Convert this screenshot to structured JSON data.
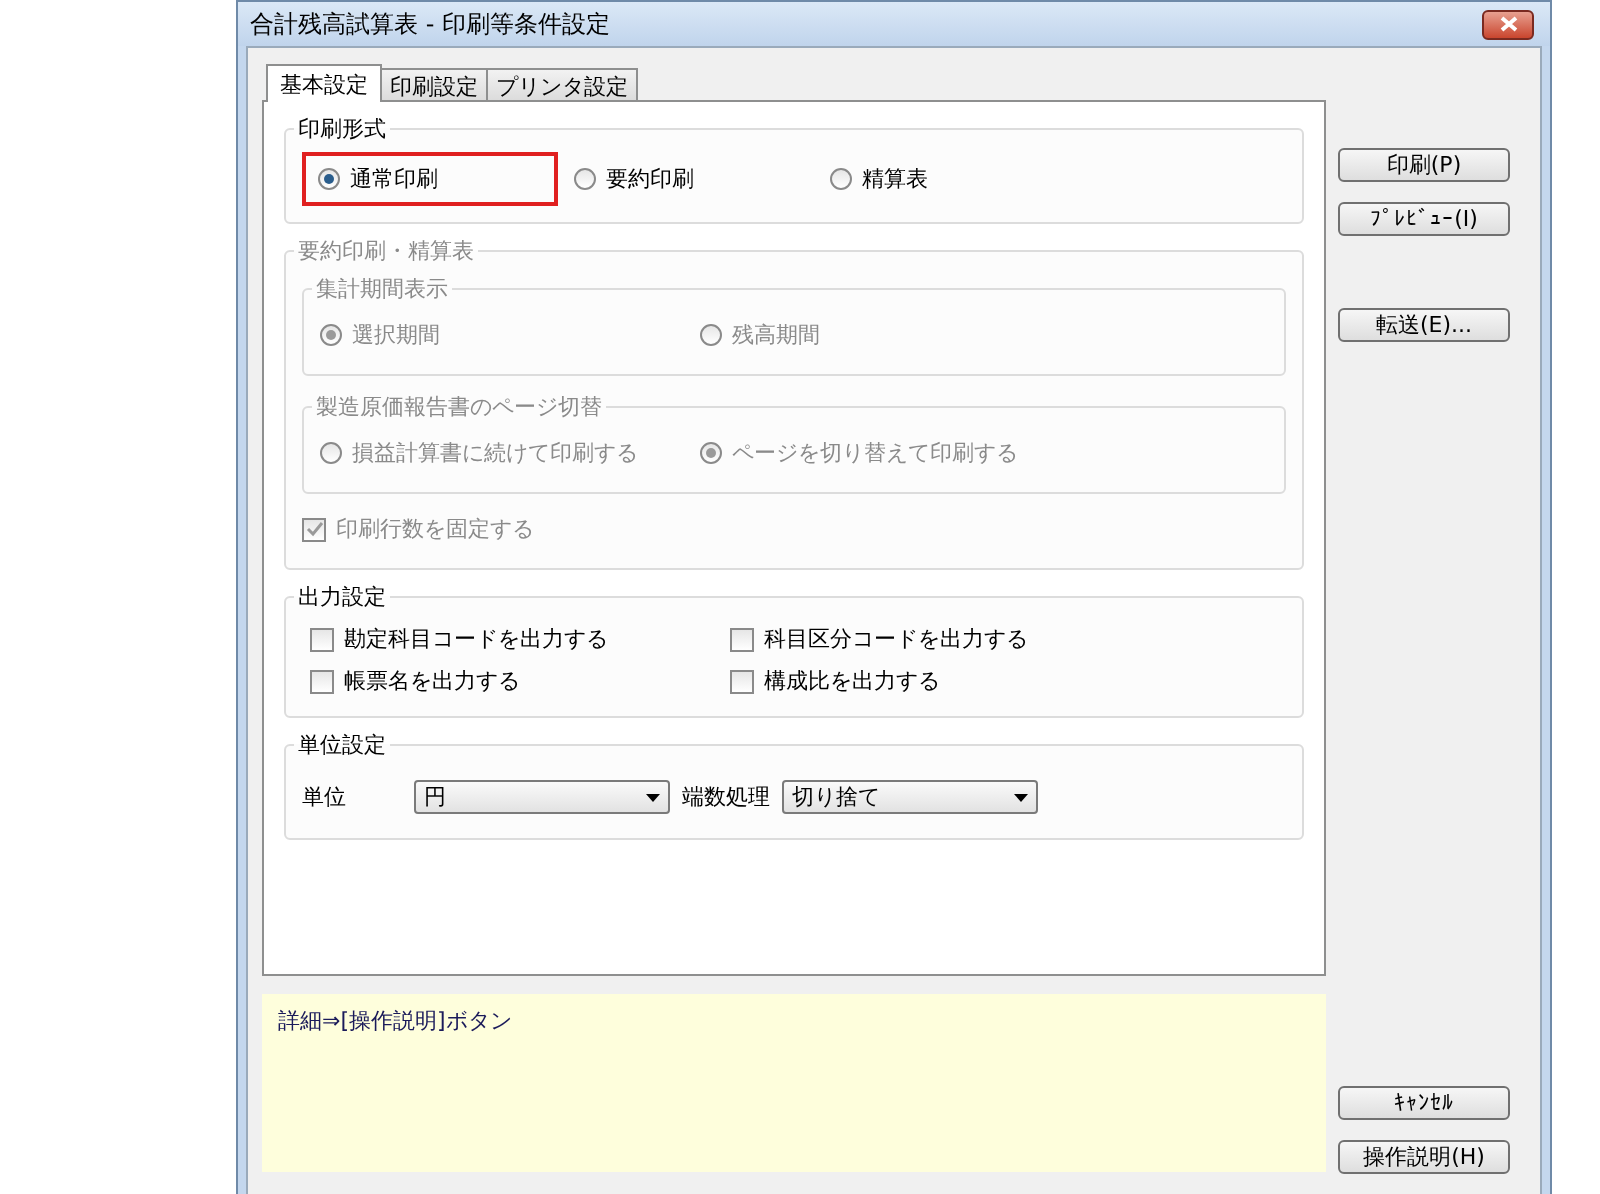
{
  "window": {
    "title": "合計残高試算表 - 印刷等条件設定"
  },
  "tabs": [
    {
      "label": "基本設定",
      "selected": true
    },
    {
      "label": "印刷設定",
      "selected": false
    },
    {
      "label": "プリンタ設定",
      "selected": false
    }
  ],
  "print_format": {
    "title": "印刷形式",
    "options": [
      {
        "label": "通常印刷",
        "selected": true,
        "highlighted": true
      },
      {
        "label": "要約印刷",
        "selected": false,
        "highlighted": false
      },
      {
        "label": "精算表",
        "selected": false,
        "highlighted": false
      }
    ]
  },
  "summary_group": {
    "title": "要約印刷・精算表",
    "disabled": true,
    "subgroups": [
      {
        "title": "集計期間表示",
        "options": [
          {
            "label": "選択期間",
            "selected": true
          },
          {
            "label": "残高期間",
            "selected": false
          }
        ]
      },
      {
        "title": "製造原価報告書のページ切替",
        "options": [
          {
            "label": "損益計算書に続けて印刷する",
            "selected": false
          },
          {
            "label": "ページを切り替えて印刷する",
            "selected": true
          }
        ]
      }
    ],
    "fixed_lines": {
      "label": "印刷行数を固定する",
      "checked": true
    }
  },
  "output_settings": {
    "title": "出力設定",
    "checkboxes": [
      {
        "label": "勘定科目コードを出力する",
        "checked": false
      },
      {
        "label": "科目区分コードを出力する",
        "checked": false
      },
      {
        "label": "帳票名を出力する",
        "checked": false
      },
      {
        "label": "構成比を出力する",
        "checked": false
      }
    ]
  },
  "unit_settings": {
    "title": "単位設定",
    "unit_label": "単位",
    "unit_value": "円",
    "rounding_label": "端数処理",
    "rounding_value": "切り捨て"
  },
  "help_text": "詳細⇒[操作説明]ボタン",
  "top_buttons": [
    "印刷(P)",
    "ﾌﾟﾚﾋﾞｭｰ(I)"
  ],
  "middle_buttons": [
    "転送(E)..."
  ],
  "bottom_buttons": [
    "ｷｬﾝｾﾙ",
    "操作説明(H)"
  ]
}
